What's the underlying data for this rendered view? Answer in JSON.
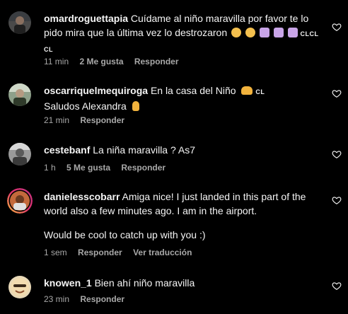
{
  "colors": {
    "background": "#000000",
    "text_primary": "#f5f5f5",
    "text_secondary": "#a8a8a8"
  },
  "comments": [
    {
      "username": "omardroguettapia",
      "text": "Cuídame al niño maravilla por favor te lo pido mira que la última vez lo destrozaron",
      "emojis": [
        "pleading-face-icon",
        "pleading-face-icon",
        "folded-hands-icon",
        "folded-hands-icon",
        "folded-hands-icon"
      ],
      "suffix": "CLCL",
      "suffix2": "CL",
      "time": "11 min",
      "likes": "2 Me gusta",
      "reply": "Responder"
    },
    {
      "username": "oscarriquelmequiroga",
      "text": "En la casa del Niño",
      "suffix": "CL",
      "text2": "Saludos Alexandra",
      "emojis": [
        "raising-hands-icon",
        "pointing-up-icon"
      ],
      "time": "21 min",
      "reply": "Responder"
    },
    {
      "username": "cestebanf",
      "text": "La niña maravilla ? As7",
      "time": "1 h",
      "likes": "5 Me gusta",
      "reply": "Responder"
    },
    {
      "username": "danielesscobarr",
      "text": "Amiga nice! I just landed in this part of the world also a few minutes ago. I am in the airport.",
      "text2": "Would be cool to catch up with you :)",
      "time": "1 sem",
      "reply": "Responder",
      "translate": "Ver traducción"
    },
    {
      "username": "knowen_1",
      "text": "Bien ahí niño maravilla",
      "time": "23 min",
      "reply": "Responder"
    }
  ]
}
